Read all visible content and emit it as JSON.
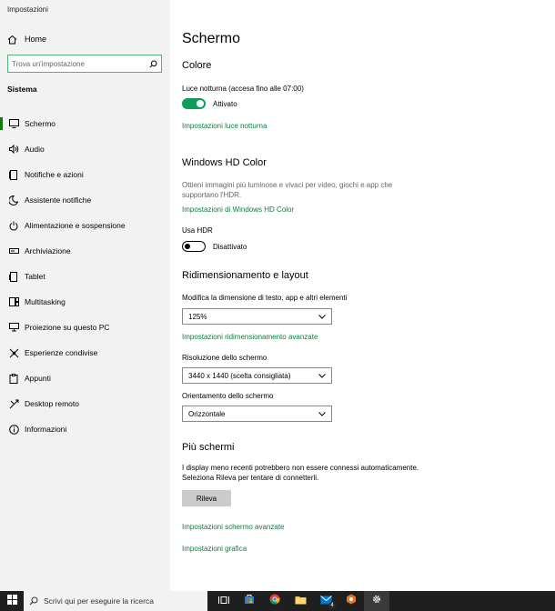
{
  "app": {
    "title": "Impostazioni"
  },
  "sidebar": {
    "home_label": "Home",
    "search_placeholder": "Trova un'impostazione",
    "section_label": "Sistema",
    "items": [
      {
        "label": "Schermo",
        "icon": "monitor-icon",
        "active": true
      },
      {
        "label": "Audio",
        "icon": "speaker-icon"
      },
      {
        "label": "Notifiche e azioni",
        "icon": "notification-icon"
      },
      {
        "label": "Assistente notifiche",
        "icon": "moon-icon"
      },
      {
        "label": "Alimentazione e sospensione",
        "icon": "power-icon"
      },
      {
        "label": "Archiviazione",
        "icon": "storage-icon"
      },
      {
        "label": "Tablet",
        "icon": "tablet-icon"
      },
      {
        "label": "Multitasking",
        "icon": "multitasking-icon"
      },
      {
        "label": "Proiezione su questo PC",
        "icon": "projection-icon"
      },
      {
        "label": "Esperienze condivise",
        "icon": "share-icon"
      },
      {
        "label": "Appunti",
        "icon": "clipboard-icon"
      },
      {
        "label": "Desktop remoto",
        "icon": "remote-icon"
      },
      {
        "label": "Informazioni",
        "icon": "info-icon"
      }
    ]
  },
  "main": {
    "title": "Schermo",
    "color": {
      "heading": "Colore",
      "night_light_label": "Luce notturna (accesa fino alle 07:00)",
      "night_light_state": "Attivato",
      "night_light_link": "Impostazioni luce notturna"
    },
    "hdr": {
      "heading": "Windows HD Color",
      "description": "Ottieni immagini più luminose e vivaci per video, giochi e app che supportano l'HDR.",
      "link": "Impostazioni di Windows HD Color",
      "use_hdr_label": "Usa HDR",
      "use_hdr_state": "Disattivato"
    },
    "scale": {
      "heading": "Ridimensionamento e layout",
      "size_label": "Modifica la dimensione di testo, app e altri elementi",
      "size_value": "125%",
      "advanced_link": "Impostazioni ridimensionamento avanzate",
      "resolution_label": "Risoluzione dello schermo",
      "resolution_value": "3440 x 1440 (scelta consigliata)",
      "orientation_label": "Orientamento dello schermo",
      "orientation_value": "Orizzontale"
    },
    "multi": {
      "heading": "Più schermi",
      "description": "I display meno recenti potrebbero non essere connessi automaticamente. Seleziona Rileva per tentare di connetterli.",
      "detect_button": "Rileva",
      "advanced_link": "Impostazioni schermo avanzate",
      "graphics_link": "Impostazioni grafica"
    }
  },
  "taskbar": {
    "search_placeholder": "Scrivi qui per eseguire la ricerca",
    "mail_badge": "4"
  }
}
